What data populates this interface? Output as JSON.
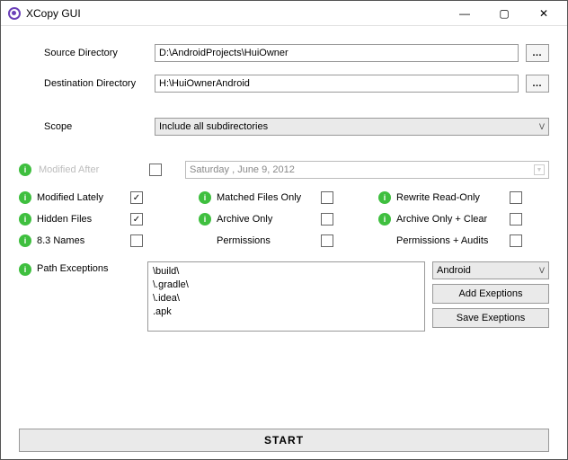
{
  "window": {
    "title": "XCopy GUI"
  },
  "source": {
    "label": "Source Directory",
    "value": "D:\\AndroidProjects\\HuiOwner"
  },
  "destination": {
    "label": "Destination Directory",
    "value": "H:\\HuiOwnerAndroid"
  },
  "scope": {
    "label": "Scope",
    "selected": "Include all subdirectories"
  },
  "modifiedAfter": {
    "label": "Modified After",
    "checked": false,
    "date": "Saturday   ,     June       9, 2012"
  },
  "opts": {
    "modifiedLately": {
      "label": "Modified Lately",
      "checked": true
    },
    "hiddenFiles": {
      "label": "Hidden Files",
      "checked": true
    },
    "names83": {
      "label": "8.3 Names",
      "checked": false
    },
    "matchedOnly": {
      "label": "Matched Files Only",
      "checked": false
    },
    "archiveOnly": {
      "label": "Archive Only",
      "checked": false
    },
    "permissions": {
      "label": "Permissions",
      "checked": false
    },
    "rewriteRO": {
      "label": "Rewrite Read-Only",
      "checked": false
    },
    "archiveClear": {
      "label": "Archive Only + Clear",
      "checked": false
    },
    "permAudits": {
      "label": "Permissions + Audits",
      "checked": false
    }
  },
  "exceptions": {
    "label": "Path Exceptions",
    "text": "\\build\\\n\\.gradle\\\n\\.idea\\\n.apk",
    "preset": "Android",
    "addLabel": "Add Exeptions",
    "saveLabel": "Save Exeptions"
  },
  "start": {
    "label": "START"
  },
  "glyphs": {
    "checkmark": "✓",
    "dots": "…",
    "caret": "ᐯ",
    "info": "i"
  }
}
